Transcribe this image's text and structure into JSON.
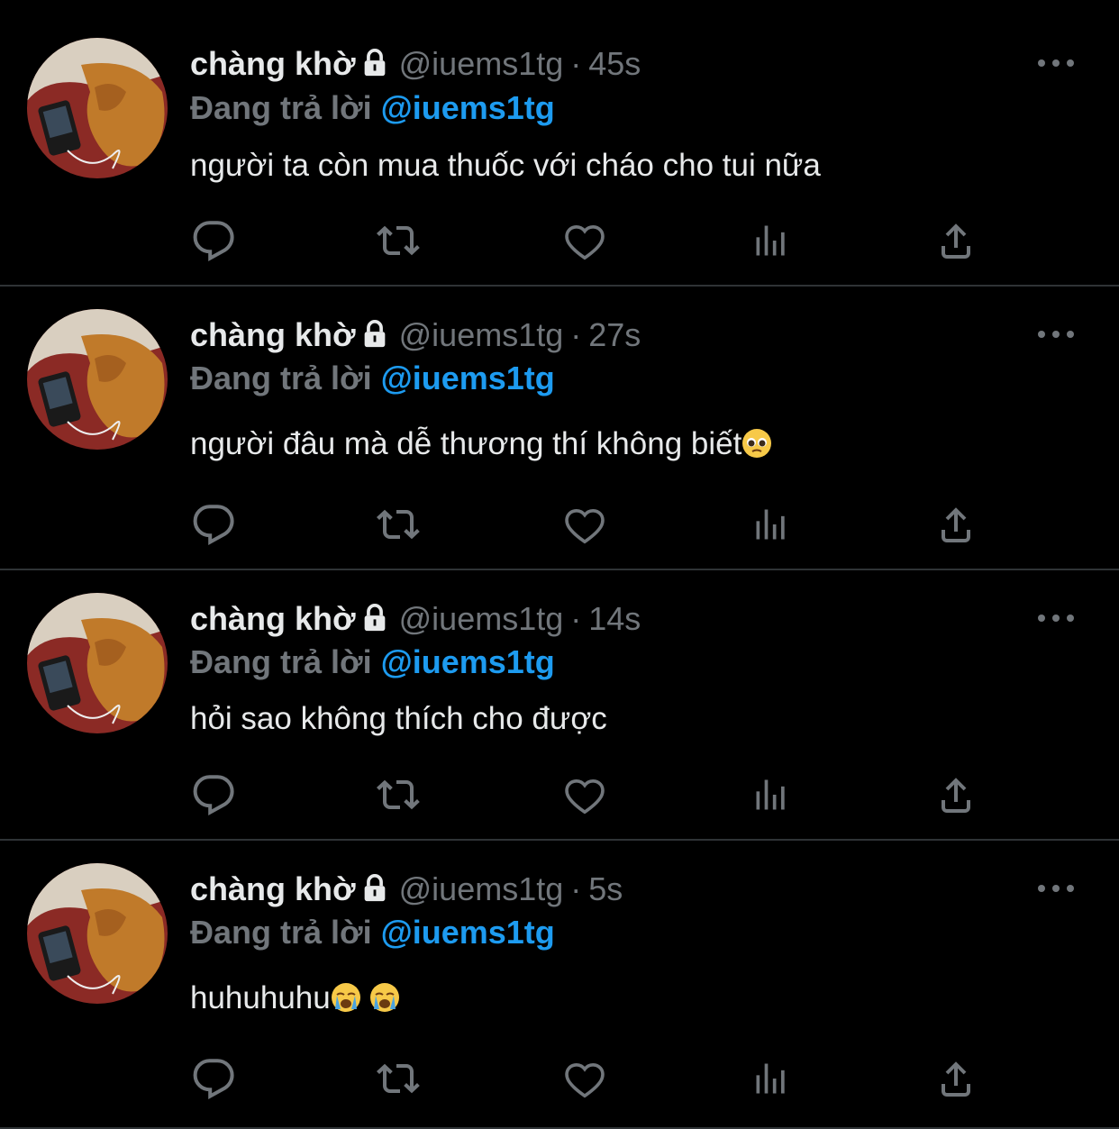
{
  "colors": {
    "background": "#000000",
    "text": "#e7e9ea",
    "muted": "#71767b",
    "accent": "#1d9bf0",
    "divider": "#2f3336"
  },
  "tweets": [
    {
      "name": "chàng khờ",
      "handle": "@iuems1tg",
      "dot": "·",
      "time": "45s",
      "replying_label": "Đang trả lời",
      "replying_to": "@iuems1tg",
      "text": "người ta còn mua thuốc với cháo cho tui nữa",
      "emojis": []
    },
    {
      "name": "chàng khờ",
      "handle": "@iuems1tg",
      "dot": "·",
      "time": "27s",
      "replying_label": "Đang trả lời",
      "replying_to": "@iuems1tg",
      "text": "người đâu mà dễ thương thí không biết",
      "emojis": [
        "pleading-face"
      ]
    },
    {
      "name": "chàng khờ",
      "handle": "@iuems1tg",
      "dot": "·",
      "time": "14s",
      "replying_label": "Đang trả lời",
      "replying_to": "@iuems1tg",
      "text": "hỏi sao không thích cho được",
      "emojis": []
    },
    {
      "name": "chàng khờ",
      "handle": "@iuems1tg",
      "dot": "·",
      "time": "5s",
      "replying_label": "Đang trả lời",
      "replying_to": "@iuems1tg",
      "text": "huhuhuhu",
      "emojis": [
        "loudly-crying-face",
        "loudly-crying-face"
      ]
    }
  ],
  "icons": {
    "reply": "reply-icon",
    "retweet": "retweet-icon",
    "like": "like-icon",
    "analytics": "analytics-icon",
    "share": "share-icon",
    "more": "more-icon",
    "lock": "lock-icon"
  }
}
